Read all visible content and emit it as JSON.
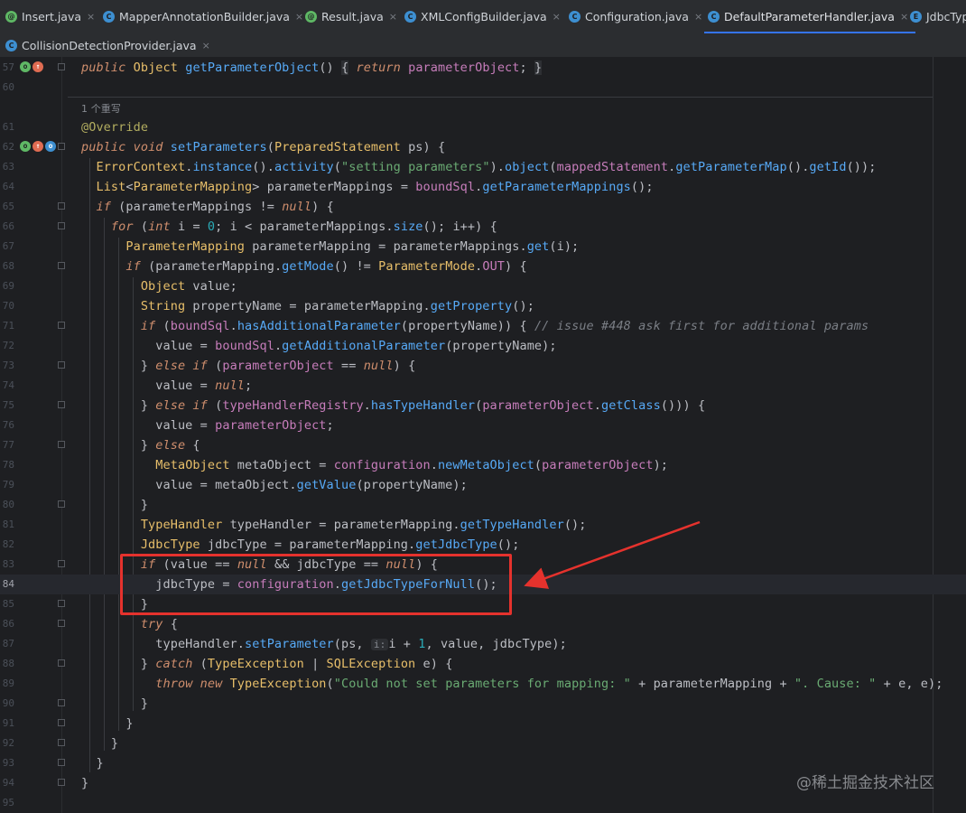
{
  "tabs": {
    "row1": [
      {
        "label": "Insert.java",
        "color": "#5fb865",
        "glyph": "@",
        "active": false
      },
      {
        "label": "MapperAnnotationBuilder.java",
        "color": "#3d8fd1",
        "glyph": "C",
        "active": false
      },
      {
        "label": "Result.java",
        "color": "#5fb865",
        "glyph": "@",
        "active": false
      },
      {
        "label": "XMLConfigBuilder.java",
        "color": "#3d8fd1",
        "glyph": "C",
        "active": false
      },
      {
        "label": "Configuration.java",
        "color": "#3d8fd1",
        "glyph": "C",
        "active": false
      },
      {
        "label": "DefaultParameterHandler.java",
        "color": "#3d8fd1",
        "glyph": "C",
        "active": true
      },
      {
        "label": "JdbcTyp",
        "color": "#3d8fd1",
        "glyph": "E",
        "active": false
      }
    ],
    "row2": [
      {
        "label": "CollisionDetectionProvider.java",
        "color": "#3d8fd1",
        "glyph": "C",
        "active": false
      }
    ],
    "close_glyph": "×"
  },
  "hint_text": "1 个重写",
  "inlay_hint": "i:",
  "watermark": "@稀土掘金技术社区",
  "highlight_box_color": "#e5322d",
  "line_numbers": [
    "57",
    "60",
    "61",
    "62",
    "63",
    "64",
    "65",
    "66",
    "67",
    "68",
    "69",
    "70",
    "71",
    "72",
    "73",
    "74",
    "75",
    "76",
    "77",
    "78",
    "79",
    "80",
    "81",
    "82",
    "83",
    "84",
    "85",
    "86",
    "87",
    "88",
    "89",
    "90",
    "91",
    "92",
    "93",
    "94",
    "95"
  ]
}
